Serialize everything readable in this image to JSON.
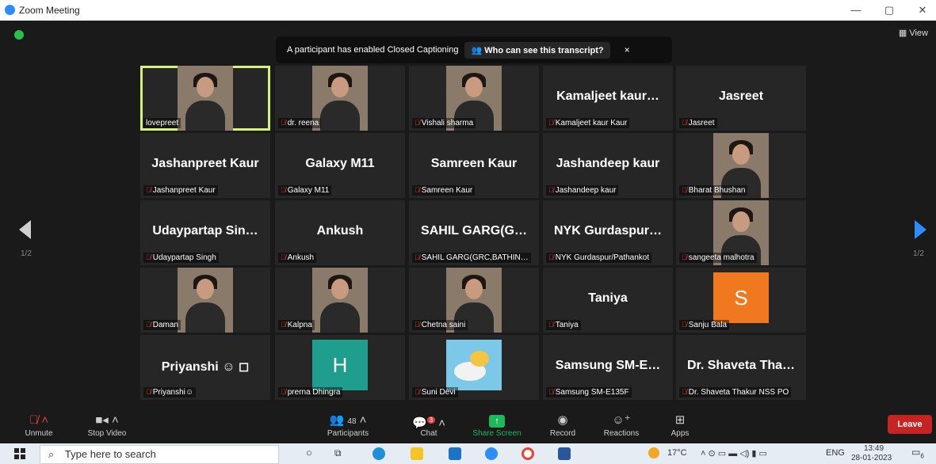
{
  "window": {
    "title": "Zoom Meeting",
    "min": "—",
    "restore": "▢",
    "close": "✕"
  },
  "view_label": "View",
  "banner": {
    "message": "A participant has enabled Closed Captioning",
    "link": "Who can see this transcript?",
    "close": "×"
  },
  "page_left": "1/2",
  "page_right": "1/2",
  "tiles": [
    {
      "name": "lovepreet",
      "kind": "video"
    },
    {
      "name": "dr. reena",
      "kind": "video"
    },
    {
      "name": "Vishali sharma",
      "kind": "video"
    },
    {
      "name": "Kamaljeet kaur Kaur",
      "display": "Kamaljeet  kaur…",
      "kind": "text"
    },
    {
      "name": "Jasreet",
      "display": "Jasreet",
      "kind": "text"
    },
    {
      "name": "Jashanpreet Kaur",
      "display": "Jashanpreet Kaur",
      "kind": "text"
    },
    {
      "name": "Galaxy M11",
      "display": "Galaxy M11",
      "kind": "text"
    },
    {
      "name": "Samreen Kaur",
      "display": "Samreen Kaur",
      "kind": "text"
    },
    {
      "name": "Jashandeep kaur",
      "display": "Jashandeep kaur",
      "kind": "text"
    },
    {
      "name": "Bharat Bhushan",
      "kind": "video"
    },
    {
      "name": "Udaypartap Singh",
      "display": "Udaypartap  Sin…",
      "kind": "text"
    },
    {
      "name": "Ankush",
      "display": "Ankush",
      "kind": "text"
    },
    {
      "name": "SAHIL GARG(GRC,BATHIN…",
      "display": "SAHIL  GARG(G…",
      "kind": "text"
    },
    {
      "name": "NYK Gurdaspur/Pathankot",
      "display": "NYK  Gurdaspur…",
      "kind": "text"
    },
    {
      "name": "sangeeta malhotra",
      "kind": "video"
    },
    {
      "name": "Daman",
      "kind": "video"
    },
    {
      "name": "Kalpna",
      "kind": "video"
    },
    {
      "name": "Chetna saini",
      "kind": "video"
    },
    {
      "name": "Taniya",
      "display": "Taniya",
      "kind": "text"
    },
    {
      "name": "Sanju Bala",
      "kind": "avatar",
      "letter": "S",
      "color": "#f0781e"
    },
    {
      "name": "Priyanshi☺",
      "display": "Priyanshi ☺ ◻",
      "kind": "text"
    },
    {
      "name": "prerna Dhingra",
      "kind": "avatar",
      "letter": "H",
      "color": "#1f9e8e"
    },
    {
      "name": "Suni Devi",
      "kind": "bird"
    },
    {
      "name": "Samsung SM-E135F",
      "display": "Samsung  SM-E…",
      "kind": "text"
    },
    {
      "name": "Dr. Shaveta Thakur NSS PO",
      "display": "Dr.  Shaveta  Tha…",
      "kind": "text"
    }
  ],
  "toolbar": {
    "unmute": "Unmute",
    "stop_video": "Stop Video",
    "participants": "Participants",
    "participants_count": "48",
    "chat": "Chat",
    "chat_badge": "3",
    "share_screen": "Share Screen",
    "record": "Record",
    "reactions": "Reactions",
    "apps": "Apps",
    "leave": "Leave"
  },
  "taskbar": {
    "search_placeholder": "Type here to search",
    "temperature": "17°C",
    "language": "ENG",
    "time": "13:49",
    "date": "28-01-2023",
    "notifications": "6"
  },
  "colors": {
    "share_screen": "#1fb85b",
    "leave": "#c52423",
    "active_speaker": "#d7f07a",
    "muted_icon": "#e0403a"
  }
}
